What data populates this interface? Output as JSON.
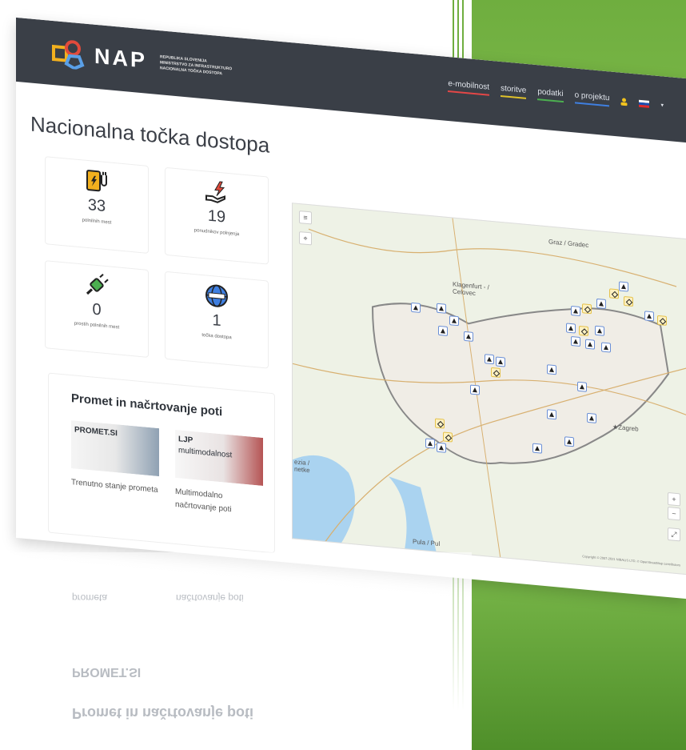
{
  "header": {
    "logo": "NAP",
    "subtitle_lines": [
      "REPUBLIKA SLOVENIJA",
      "MINISTRSTVO ZA INFRASTRUKTURO",
      "NACIONALNA TOČKA DOSTOPA"
    ],
    "nav": [
      "e-mobilnost",
      "storitve",
      "podatki",
      "o projektu"
    ]
  },
  "page_title": "Nacionalna točka dostopa",
  "stats": [
    {
      "icon": "charging-station-icon",
      "value": "33",
      "label": "polnilnih mest"
    },
    {
      "icon": "hand-energy-icon",
      "value": "19",
      "label": "ponudnikov polnjenja"
    },
    {
      "icon": "unplugged-icon",
      "value": "0",
      "label": "prostih polnilnih mest"
    },
    {
      "icon": "globe-icon",
      "value": "1",
      "label": "točka dostopa"
    }
  ],
  "route": {
    "title": "Promet in načrtovanje poti",
    "tiles": [
      {
        "name": "PROMET.SI",
        "name2": "",
        "description": "Trenutno stanje prometa"
      },
      {
        "name": "LJP",
        "name2": "multimodalnost",
        "description": "Multimodalno načrtovanje poti"
      }
    ]
  },
  "map": {
    "places": [
      "Graz / Gradec",
      "Klagenfurt - / Celovec",
      "★Zagreb",
      "ezia / netke",
      "Pula / Pul"
    ],
    "zoom_in": "+",
    "zoom_out": "−",
    "copyright": "Copyright © 2007-2021 NIBALIS LTD. © OpenStreetMap contributors"
  },
  "colors": {
    "topbar": "#3a3f47",
    "accent_green": "#6fae3f",
    "nav_emobilnost": "#e44747",
    "nav_storitve": "#e0c22a",
    "nav_podatki": "#4caf50",
    "nav_oprojektu": "#3f7fe0"
  }
}
